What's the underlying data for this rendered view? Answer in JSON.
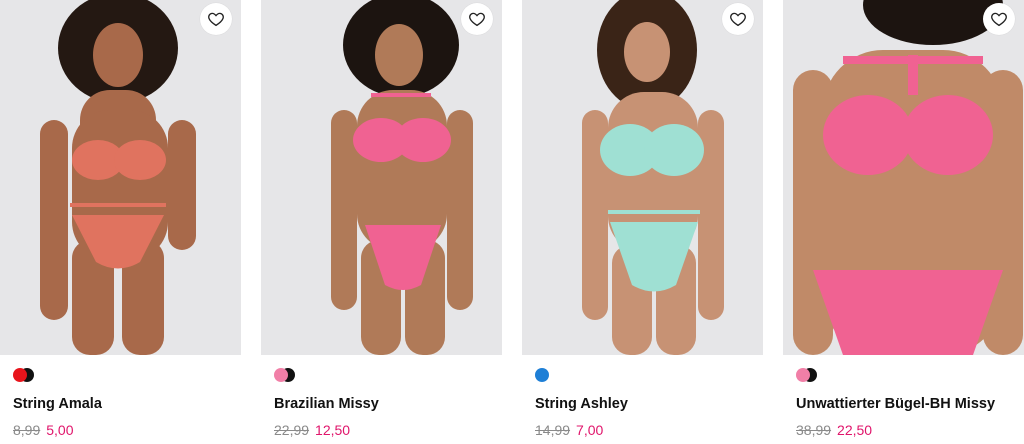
{
  "products": [
    {
      "name": "String Amala",
      "old_price": "8,99",
      "new_price": "5,00",
      "swatches": [
        "#e8141b",
        "#111111"
      ],
      "set_color": "#e0735f",
      "skin": "#a8694a",
      "hair": "#241812"
    },
    {
      "name": "Brazilian Missy",
      "old_price": "22,99",
      "new_price": "12,50",
      "swatches": [
        "#f17fa7",
        "#111111"
      ],
      "set_color": "#f06292",
      "skin": "#b07a58",
      "hair": "#1c1410"
    },
    {
      "name": "String Ashley",
      "old_price": "14,99",
      "new_price": "7,00",
      "swatches": [
        "#1e7fd6"
      ],
      "set_color": "#9fe0d3",
      "skin": "#c79274",
      "hair": "#3a2417"
    },
    {
      "name": "Unwattierter Bügel-BH Missy",
      "old_price": "38,99",
      "new_price": "22,50",
      "swatches": [
        "#f17fa7",
        "#111111"
      ],
      "set_color": "#f06292",
      "skin": "#c08a68",
      "hair": "#1c1410"
    }
  ],
  "icons": {
    "favorite": "heart-outline-icon"
  },
  "colors": {
    "sale": "#e0156b",
    "old_price": "#8a8a8a"
  }
}
